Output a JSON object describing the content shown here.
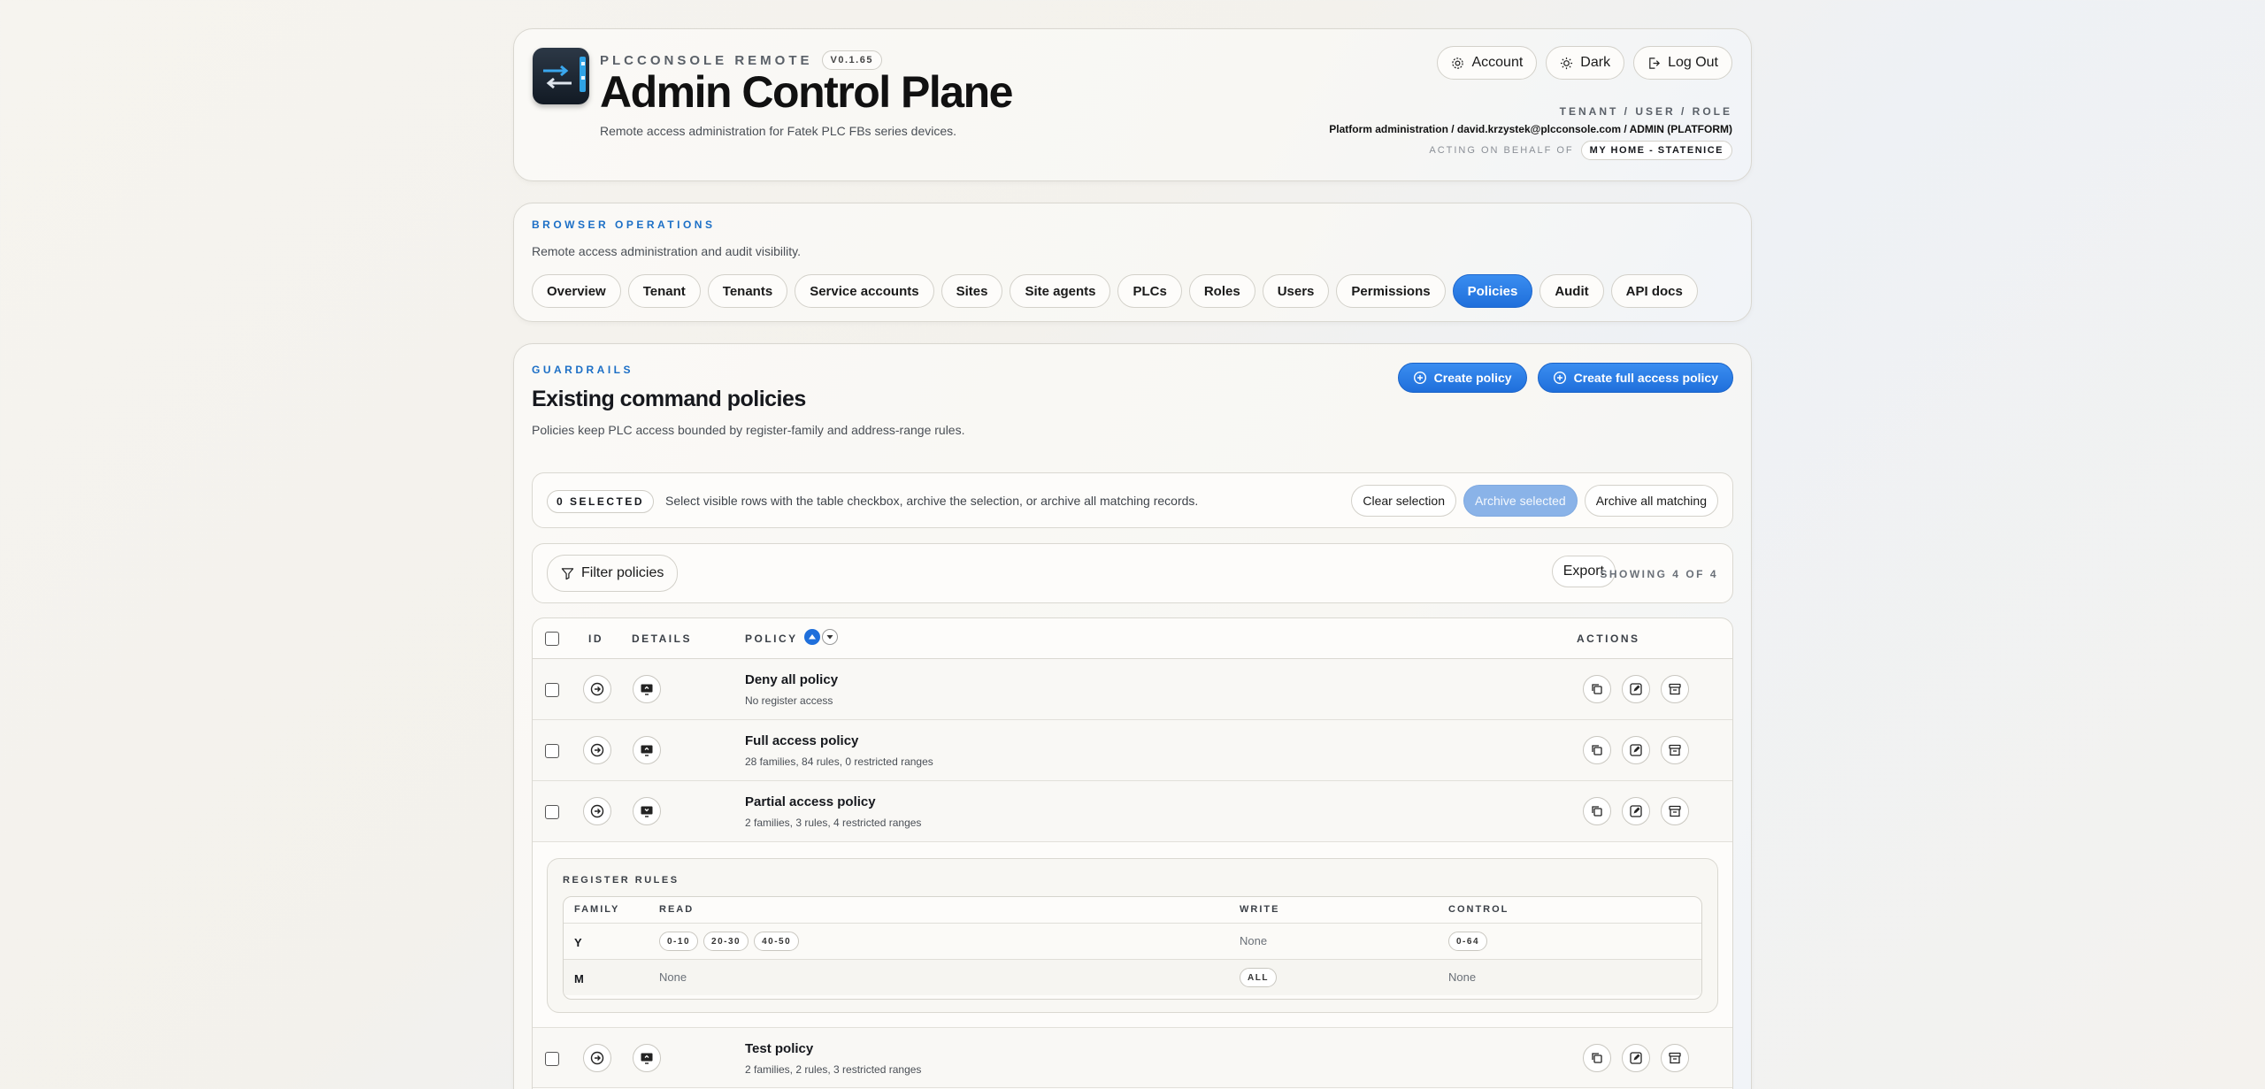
{
  "header": {
    "brand": "PLCCONSOLE REMOTE",
    "version": "V0.1.65",
    "title": "Admin Control Plane",
    "subtitle": "Remote access administration for Fatek PLC FBs series devices.",
    "buttons": {
      "account": "Account",
      "theme": "Dark",
      "logout": "Log Out"
    },
    "meta_label": "TENANT / USER / ROLE",
    "meta_value": "Platform administration / david.krzystek@plcconsole.com / ADMIN (PLATFORM)",
    "acting_label": "ACTING ON BEHALF OF",
    "acting_value": "MY HOME - STATENICE"
  },
  "ops": {
    "eyebrow": "BROWSER OPERATIONS",
    "description": "Remote access administration and audit visibility.",
    "tabs": [
      "Overview",
      "Tenant",
      "Tenants",
      "Service accounts",
      "Sites",
      "Site agents",
      "PLCs",
      "Roles",
      "Users",
      "Permissions",
      "Policies",
      "Audit",
      "API docs"
    ],
    "active_tab": "Policies"
  },
  "guardrails": {
    "eyebrow": "GUARDRAILS",
    "title": "Existing command policies",
    "description": "Policies keep PLC access bounded by register-family and address-range rules.",
    "create_button": "Create policy",
    "create_full_button": "Create full access policy",
    "selection": {
      "count": "0 SELECTED",
      "hint": "Select visible rows with the table checkbox, archive the selection, or archive all matching records.",
      "clear": "Clear selection",
      "archive_selected": "Archive selected",
      "archive_all": "Archive all matching"
    },
    "filter_label": "Filter policies",
    "export_label": "Export",
    "showing": "SHOWING 4 OF 4",
    "columns": {
      "id": "ID",
      "details": "DETAILS",
      "policy": "POLICY",
      "actions": "ACTIONS"
    },
    "rows": [
      {
        "name": "Deny all policy",
        "summary": "No register access"
      },
      {
        "name": "Full access policy",
        "summary": "28 families, 84 rules, 0 restricted ranges"
      },
      {
        "name": "Partial access policy",
        "summary": "2 families, 3 rules, 4 restricted ranges"
      },
      {
        "name": "Test policy",
        "summary": "2 families, 2 rules, 3 restricted ranges"
      }
    ],
    "register_rules": {
      "label": "REGISTER RULES",
      "columns": {
        "family": "FAMILY",
        "read": "READ",
        "write": "WRITE",
        "control": "CONTROL"
      },
      "rows": [
        {
          "family": "Y",
          "read": [
            "0-10",
            "20-30",
            "40-50"
          ],
          "write": "None",
          "control": [
            "0-64"
          ]
        },
        {
          "family": "M",
          "read": "None",
          "write": [
            "ALL"
          ],
          "control": "None"
        }
      ]
    }
  }
}
